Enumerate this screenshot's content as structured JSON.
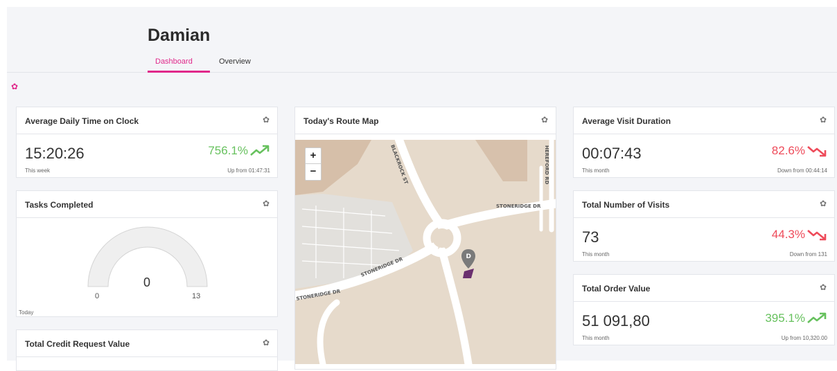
{
  "header": {
    "title": "Damian",
    "tabs": [
      {
        "label": "Dashboard",
        "active": true
      },
      {
        "label": "Overview",
        "active": false
      }
    ]
  },
  "colors": {
    "accent": "#e0288a",
    "up": "#67c15e",
    "down": "#ee4b5a",
    "background": "#f4f5f8"
  },
  "widgets": {
    "daily_time": {
      "title": "Average Daily Time on Clock",
      "value": "15:20:26",
      "period": "This week",
      "change": "756.1%",
      "trend": "up",
      "sub": "Up from 01:47:31"
    },
    "tasks": {
      "title": "Tasks Completed",
      "value": "0",
      "min": "0",
      "max": "13",
      "period": "Today",
      "fill_fraction": 0
    },
    "credit": {
      "title": "Total Credit Request Value"
    },
    "route_map": {
      "title": "Today's Route Map",
      "zoom_in": "+",
      "zoom_out": "−",
      "streets": [
        "BLACKROCK ST",
        "HEREFORD RD",
        "STONERIDGE DR",
        "STONERIDGE DR",
        "STONERIDGE DR"
      ],
      "marker_label": "D"
    },
    "visit_duration": {
      "title": "Average Visit Duration",
      "value": "00:07:43",
      "period": "This month",
      "change": "82.6%",
      "trend": "down",
      "sub": "Down from 00:44:14"
    },
    "visits": {
      "title": "Total Number of Visits",
      "value": "73",
      "period": "This month",
      "change": "44.3%",
      "trend": "down",
      "sub": "Down from 131"
    },
    "order_value": {
      "title": "Total Order Value",
      "value": "51 091,80",
      "period": "This month",
      "change": "395.1%",
      "trend": "up",
      "sub": "Up from 10,320.00"
    }
  },
  "icons": {
    "settings": "gear-icon",
    "trend_up": "trend-up-icon",
    "trend_down": "trend-down-icon",
    "map_marker": "map-marker-icon"
  }
}
